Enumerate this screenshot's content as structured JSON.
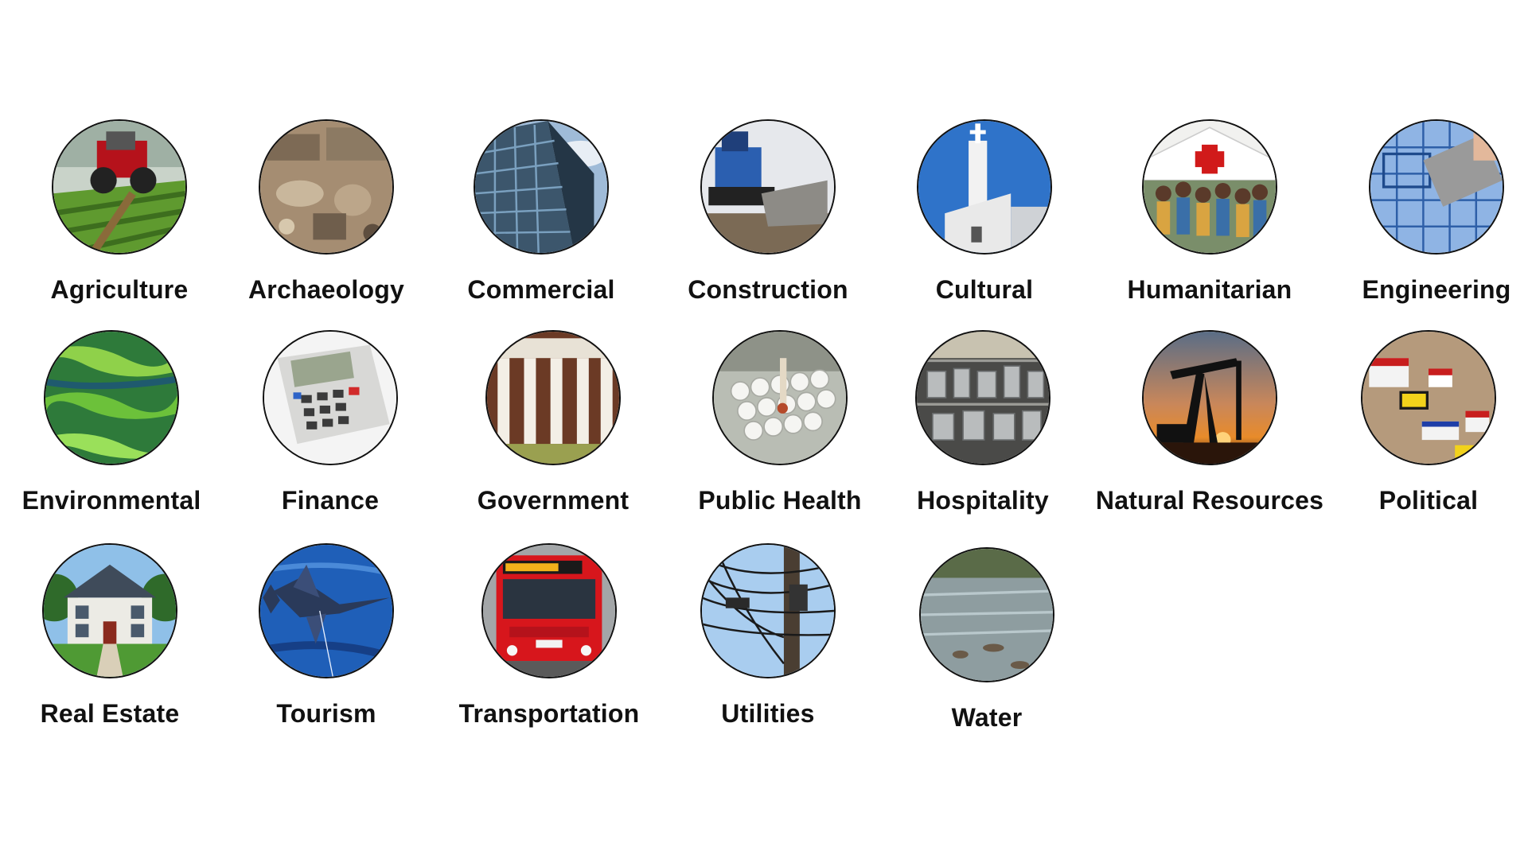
{
  "categories": [
    {
      "label": "Agriculture",
      "icon": "tractor-field-icon"
    },
    {
      "label": "Archaeology",
      "icon": "excavation-ruins-icon"
    },
    {
      "label": "Commercial",
      "icon": "glass-office-building-icon"
    },
    {
      "label": "Construction",
      "icon": "bulldozer-icon"
    },
    {
      "label": "Cultural",
      "icon": "church-icon"
    },
    {
      "label": "Humanitarian",
      "icon": "red-cross-crowd-icon"
    },
    {
      "label": "Engineering",
      "icon": "blueprint-approved-stamp-icon"
    },
    {
      "label": "Environmental",
      "icon": "algae-water-icon"
    },
    {
      "label": "Finance",
      "icon": "calculator-icon"
    },
    {
      "label": "Government",
      "icon": "columned-building-icon"
    },
    {
      "label": "Public Health",
      "icon": "lab-vials-icon"
    },
    {
      "label": "Hospitality",
      "icon": "kitchen-pots-icon"
    },
    {
      "label": "Natural Resources",
      "icon": "oil-pump-sunset-icon"
    },
    {
      "label": "Political",
      "icon": "campaign-signs-icon"
    },
    {
      "label": "Real Estate",
      "icon": "house-icon"
    },
    {
      "label": "Tourism",
      "icon": "marlin-fish-icon"
    },
    {
      "label": "Transportation",
      "icon": "red-bus-icon"
    },
    {
      "label": "Utilities",
      "icon": "utility-pole-icon"
    },
    {
      "label": "Water",
      "icon": "river-icon"
    }
  ],
  "colors": {
    "label": "#111111",
    "border": "#111111",
    "background": "#ffffff"
  }
}
